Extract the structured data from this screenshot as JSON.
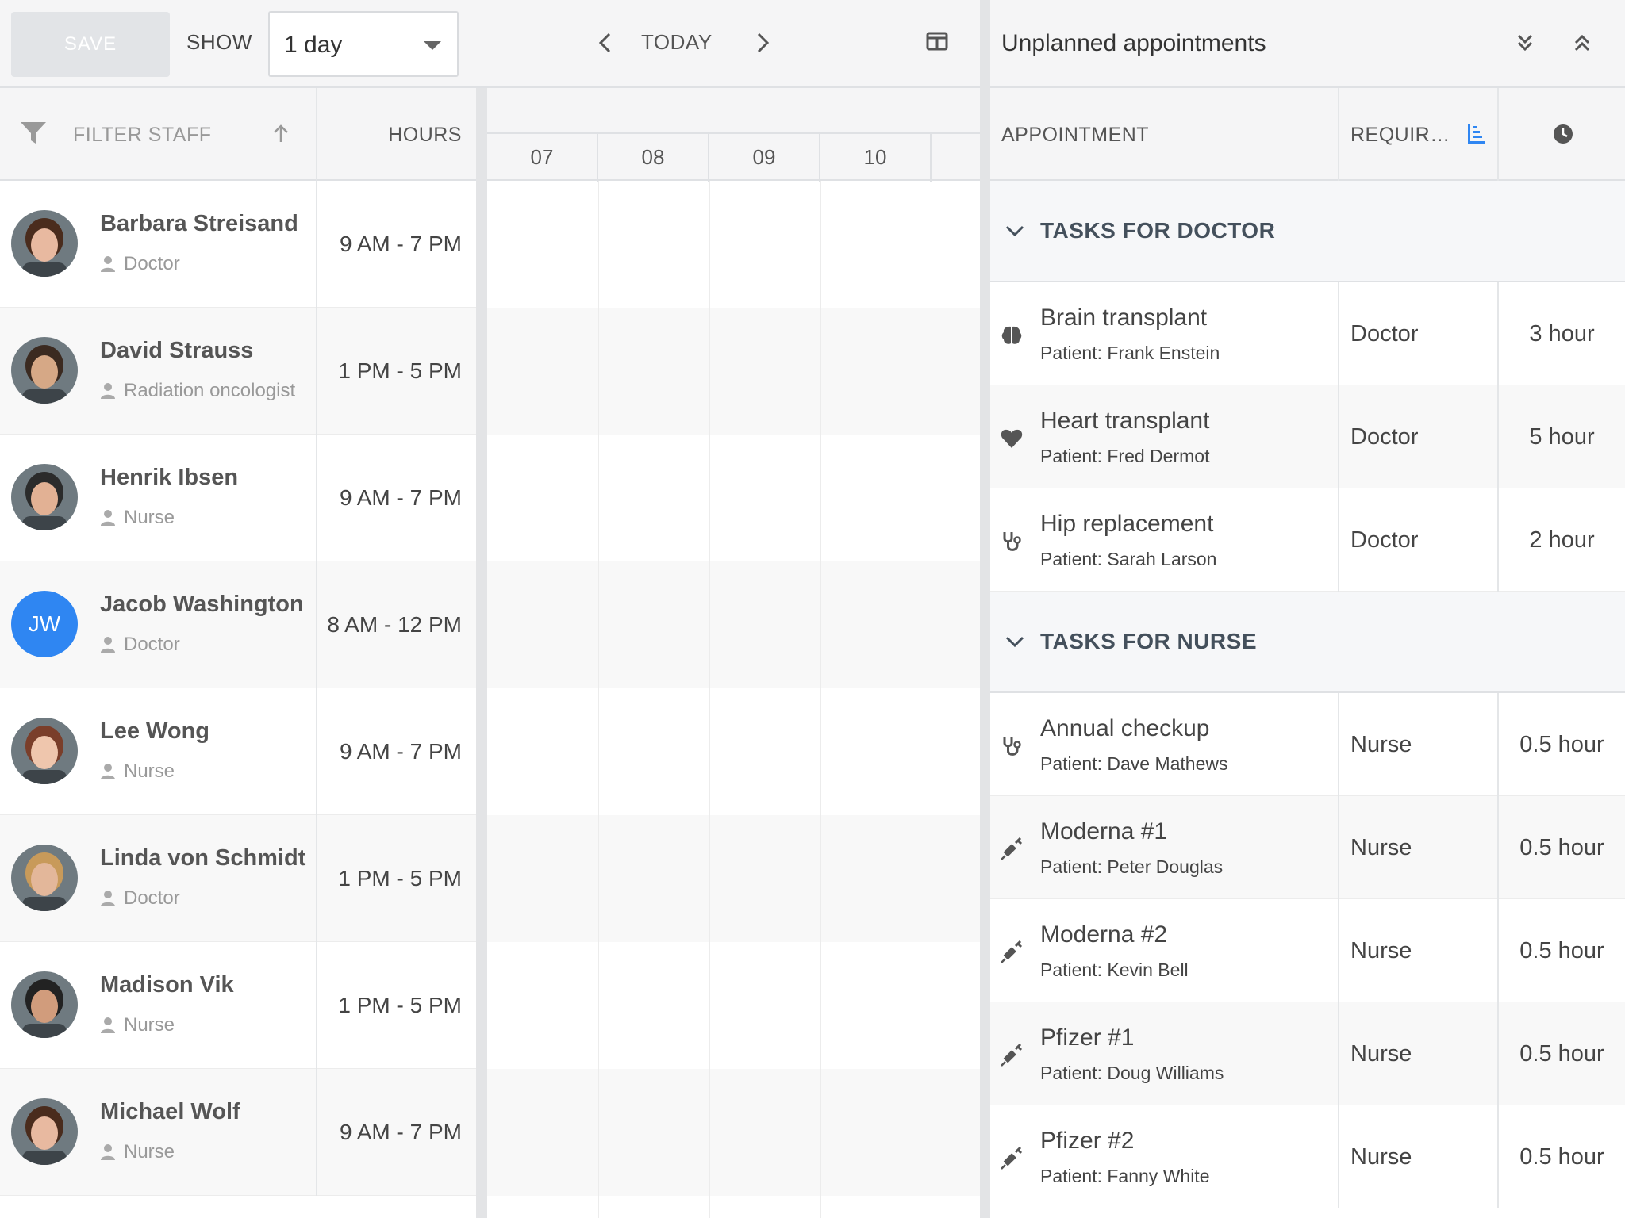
{
  "toolbar": {
    "save_label": "SAVE",
    "show_label": "SHOW",
    "range_value": "1 day",
    "today_label": "TODAY"
  },
  "staff_table": {
    "filter_label": "FILTER STAFF",
    "hours_label": "HOURS",
    "rows": [
      {
        "name": "Barbara Streisand",
        "role": "Doctor",
        "hours": "9 AM - 7 PM",
        "avatar": "photo"
      },
      {
        "name": "David Strauss",
        "role": "Radiation oncologist",
        "hours": "1 PM - 5 PM",
        "avatar": "photo"
      },
      {
        "name": "Henrik Ibsen",
        "role": "Nurse",
        "hours": "9 AM - 7 PM",
        "avatar": "photo"
      },
      {
        "name": "Jacob Washington",
        "role": "Doctor",
        "hours": "8 AM - 12 PM",
        "avatar": "initials",
        "initials": "JW"
      },
      {
        "name": "Lee Wong",
        "role": "Nurse",
        "hours": "9 AM - 7 PM",
        "avatar": "photo"
      },
      {
        "name": "Linda von Schmidt",
        "role": "Doctor",
        "hours": "1 PM - 5 PM",
        "avatar": "photo"
      },
      {
        "name": "Madison Vik",
        "role": "Nurse",
        "hours": "1 PM - 5 PM",
        "avatar": "photo"
      },
      {
        "name": "Michael Wolf",
        "role": "Nurse",
        "hours": "9 AM - 7 PM",
        "avatar": "photo"
      }
    ]
  },
  "schedule": {
    "hours": [
      "07",
      "08",
      "09",
      "10"
    ]
  },
  "unplanned": {
    "title": "Unplanned appointments",
    "col_appointment": "APPOINTMENT",
    "col_requires": "REQUIRES",
    "groups": [
      {
        "title": "TASKS FOR DOCTOR",
        "tasks": [
          {
            "name": "Brain transplant",
            "patient": "Patient: Frank Enstein",
            "requires": "Doctor",
            "duration": "3 hour",
            "icon": "brain-icon"
          },
          {
            "name": "Heart transplant",
            "patient": "Patient: Fred Dermot",
            "requires": "Doctor",
            "duration": "5 hour",
            "icon": "heart-icon"
          },
          {
            "name": "Hip replacement",
            "patient": "Patient: Sarah Larson",
            "requires": "Doctor",
            "duration": "2 hour",
            "icon": "stethoscope-icon"
          }
        ]
      },
      {
        "title": "TASKS FOR NURSE",
        "tasks": [
          {
            "name": "Annual checkup",
            "patient": "Patient: Dave Mathews",
            "requires": "Nurse",
            "duration": "0.5 hour",
            "icon": "stethoscope-icon"
          },
          {
            "name": "Moderna #1",
            "patient": "Patient: Peter Douglas",
            "requires": "Nurse",
            "duration": "0.5 hour",
            "icon": "syringe-icon"
          },
          {
            "name": "Moderna #2",
            "patient": "Patient: Kevin Bell",
            "requires": "Nurse",
            "duration": "0.5 hour",
            "icon": "syringe-icon"
          },
          {
            "name": "Pfizer #1",
            "patient": "Patient: Doug Williams",
            "requires": "Nurse",
            "duration": "0.5 hour",
            "icon": "syringe-icon"
          },
          {
            "name": "Pfizer #2",
            "patient": "Patient: Fanny White",
            "requires": "Nurse",
            "duration": "0.5 hour",
            "icon": "syringe-icon"
          }
        ]
      }
    ]
  },
  "colors": {
    "accent": "#2f86f2",
    "toolbar_bg": "#f5f5f6",
    "group_title": "#44505c"
  }
}
